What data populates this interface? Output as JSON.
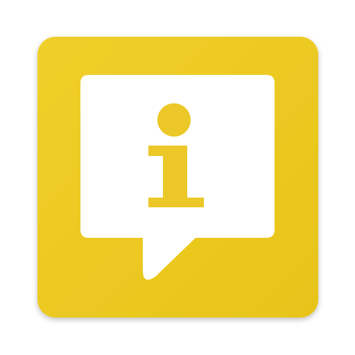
{
  "icon": {
    "name": "info-speech-bubble-icon",
    "colors": {
      "tile_light": "#F0CF2A",
      "tile_dark": "#E8C419",
      "bubble": "#FFFFFF",
      "glyph": "#EBC827"
    }
  }
}
